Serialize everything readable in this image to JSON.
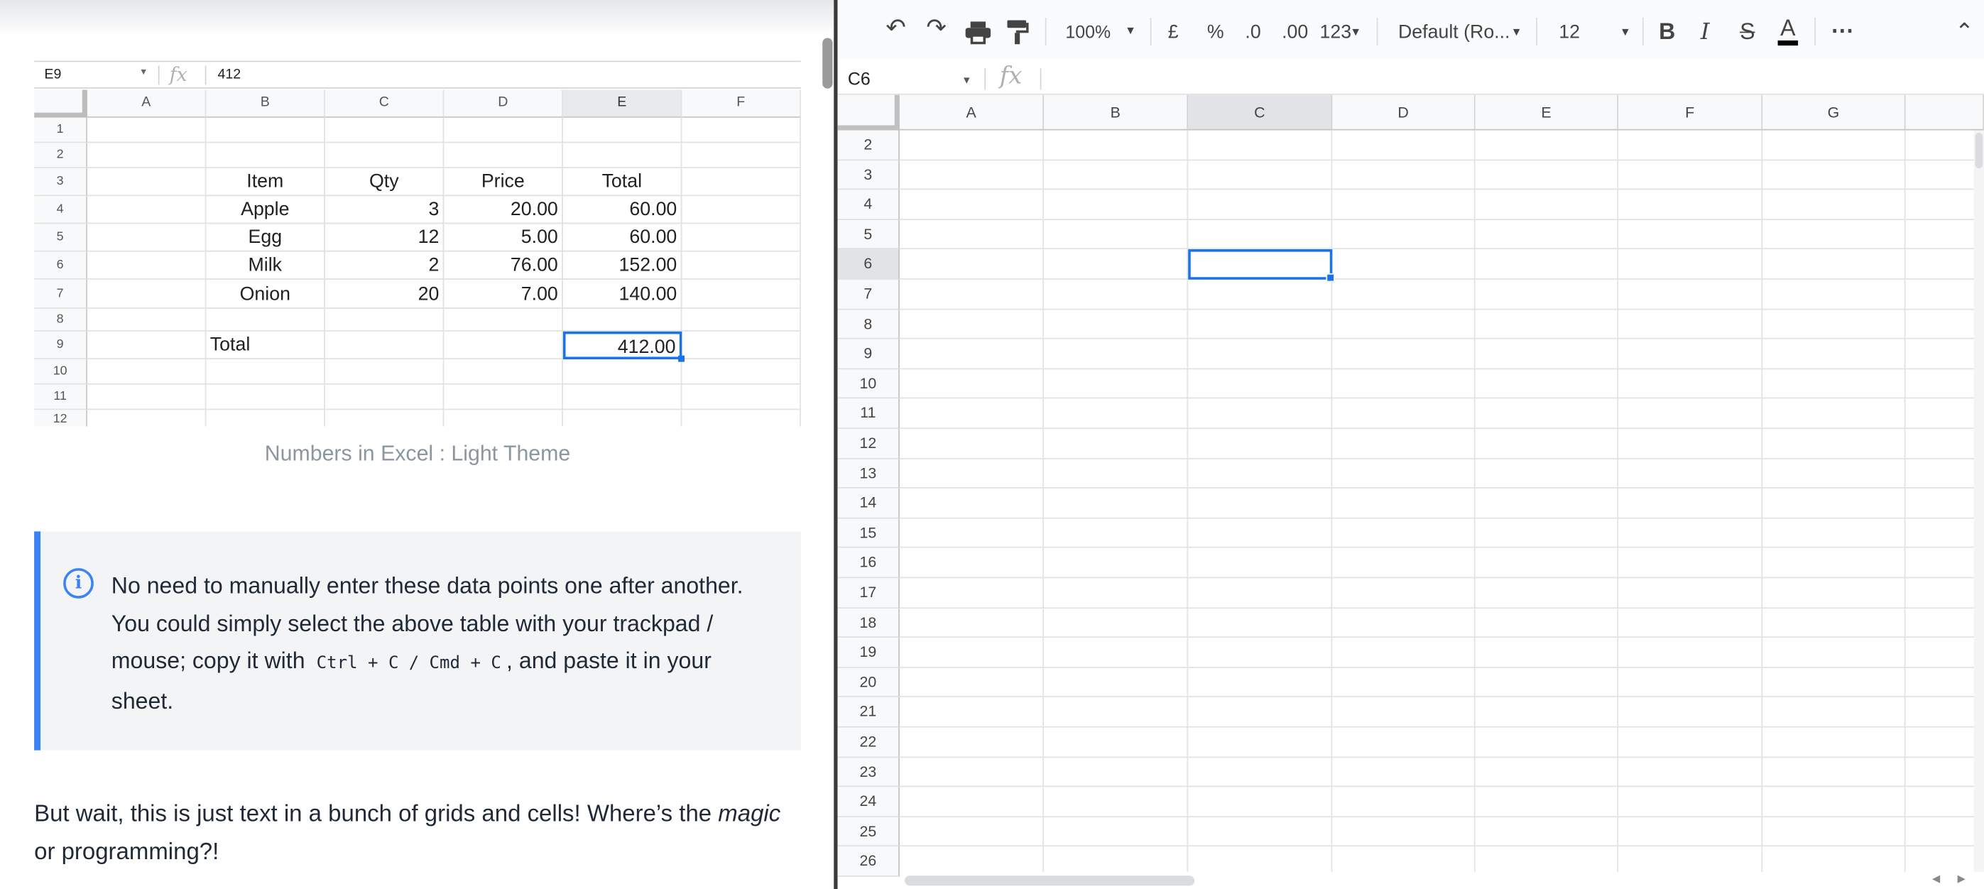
{
  "article": {
    "spreadsheet": {
      "name_box": "E9",
      "formula_value": "412",
      "columns": [
        "A",
        "B",
        "C",
        "D",
        "E",
        "F"
      ],
      "rows": [
        "1",
        "2",
        "3",
        "4",
        "5",
        "6",
        "7",
        "8",
        "9",
        "10",
        "11",
        "12"
      ],
      "table_header": {
        "item": "Item",
        "qty": "Qty",
        "price": "Price",
        "total": "Total"
      },
      "table_rows": [
        {
          "item": "Apple",
          "qty": "3",
          "price": "20.00",
          "total": "60.00"
        },
        {
          "item": "Egg",
          "qty": "12",
          "price": "5.00",
          "total": "60.00"
        },
        {
          "item": "Milk",
          "qty": "2",
          "price": "76.00",
          "total": "152.00"
        },
        {
          "item": "Onion",
          "qty": "20",
          "price": "7.00",
          "total": "140.00"
        }
      ],
      "total_label": "Total",
      "total_value": "412.00"
    },
    "caption": "Numbers in Excel : Light Theme",
    "note": {
      "text_1": "No need to manually enter these data points one after another. You could simply select the above table with your trackpad / mouse; copy it with",
      "code_1": "Ctrl + C",
      "sep": "/",
      "code_2": "Cmd + C",
      "text_2": ", and paste it in your sheet."
    },
    "paragraph": {
      "before": "But wait, this is just text in a bunch of grids and cells! Where’s the",
      "emphasis": "magic",
      "after": "or programming?!"
    }
  },
  "sheets": {
    "toolbar": {
      "zoom": "100%",
      "currency": "£",
      "percent": "%",
      "decrease_decimal": ".0",
      "increase_decimal": ".00",
      "number_format": "123",
      "font": "Default (Ro...",
      "font_size": "12",
      "bold": "B",
      "italic": "I",
      "strikethrough": "S",
      "text_color": "A",
      "more": "⋯"
    },
    "name_box": "C6",
    "formula_value": "",
    "columns": [
      "A",
      "B",
      "C",
      "D",
      "E",
      "F",
      "G"
    ],
    "rows": [
      "2",
      "3",
      "4",
      "5",
      "6",
      "7",
      "8",
      "9",
      "10",
      "11",
      "12",
      "13",
      "14",
      "15",
      "16",
      "17",
      "18",
      "19",
      "20",
      "21",
      "22",
      "23",
      "24",
      "25",
      "26"
    ],
    "selected_cell": "C6"
  }
}
